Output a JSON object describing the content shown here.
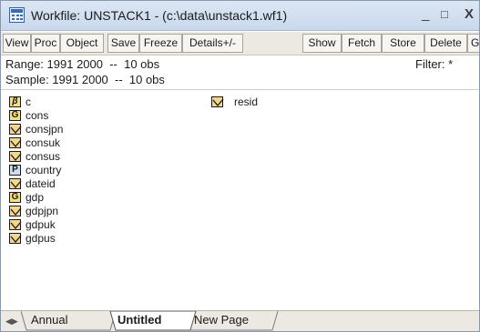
{
  "window": {
    "title": "Workfile: UNSTACK1 - (c:\\data\\unstack1.wf1)",
    "minimize_glyph": "_",
    "maximize_glyph": "□",
    "close_glyph": "X"
  },
  "toolbar": {
    "buttons": [
      "View",
      "Proc",
      "Object",
      "Save",
      "Freeze",
      "Details+/-",
      "Show",
      "Fetch",
      "Store",
      "Delete",
      "G"
    ]
  },
  "info": {
    "range_label": "Range:",
    "range_value": "1991 2000  --  10 obs",
    "sample_label": "Sample:",
    "sample_value": "1991 2000  --  10 obs",
    "filter_label": "Filter: *"
  },
  "objects": [
    {
      "name": "c",
      "icon": "beta-icon",
      "glyph": "β"
    },
    {
      "name": "cons",
      "icon": "group-icon",
      "glyph": "G"
    },
    {
      "name": "consjpn",
      "icon": "series-icon"
    },
    {
      "name": "consuk",
      "icon": "series-icon"
    },
    {
      "name": "consus",
      "icon": "series-icon"
    },
    {
      "name": "country",
      "icon": "pool-icon",
      "glyph": "P"
    },
    {
      "name": "dateid",
      "icon": "series-icon"
    },
    {
      "name": "gdp",
      "icon": "group-icon",
      "glyph": "G"
    },
    {
      "name": "gdpjpn",
      "icon": "series-icon"
    },
    {
      "name": "gdpuk",
      "icon": "series-icon"
    },
    {
      "name": "gdpus",
      "icon": "series-icon"
    },
    {
      "name": "resid",
      "icon": "series-icon"
    }
  ],
  "tabs": [
    "Annual",
    "Untitled",
    "New Page"
  ],
  "active_tab": "Untitled",
  "colors": {
    "title_gradient_top": "#dce7f5",
    "toolbar_bg": "#ece9e2",
    "icon_fill": "#f5d58a",
    "letter_icon_fill": "#f7e07c"
  }
}
